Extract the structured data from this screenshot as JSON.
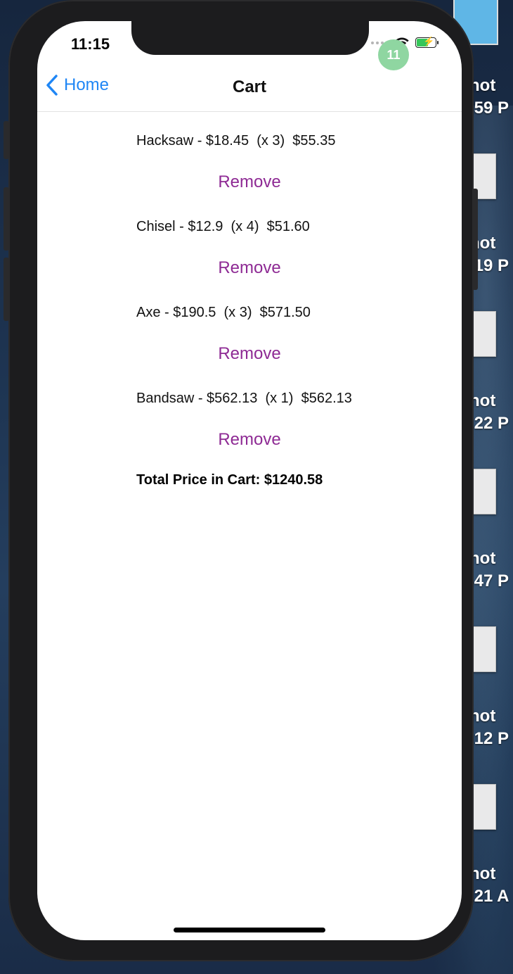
{
  "status_bar": {
    "time": "11:15"
  },
  "nav": {
    "back_label": "Home",
    "title": "Cart",
    "badge_count": "11"
  },
  "cart": {
    "items": [
      {
        "text": "Hacksaw - $18.45  (x 3)  $55.35",
        "remove_label": "Remove"
      },
      {
        "text": "Chisel - $12.9  (x 4)  $51.60",
        "remove_label": "Remove"
      },
      {
        "text": "Axe - $190.5  (x 3)  $571.50",
        "remove_label": "Remove"
      },
      {
        "text": "Bandsaw - $562.13  (x 1)  $562.13",
        "remove_label": "Remove"
      }
    ],
    "total": "Total Price in Cart: $1240.58"
  },
  "desktop": {
    "labels": [
      "hot\n.59 P",
      "hot\n.19 P",
      "hot\n.22 P",
      "hot\n.47 P",
      "hot\n.12 P",
      "hot\n.21 A"
    ]
  },
  "colors": {
    "accent_blue": "#1f86f5",
    "remove_purple": "#8e2a94",
    "badge_green": "#8fd6a1",
    "battery_green": "#35c759"
  }
}
